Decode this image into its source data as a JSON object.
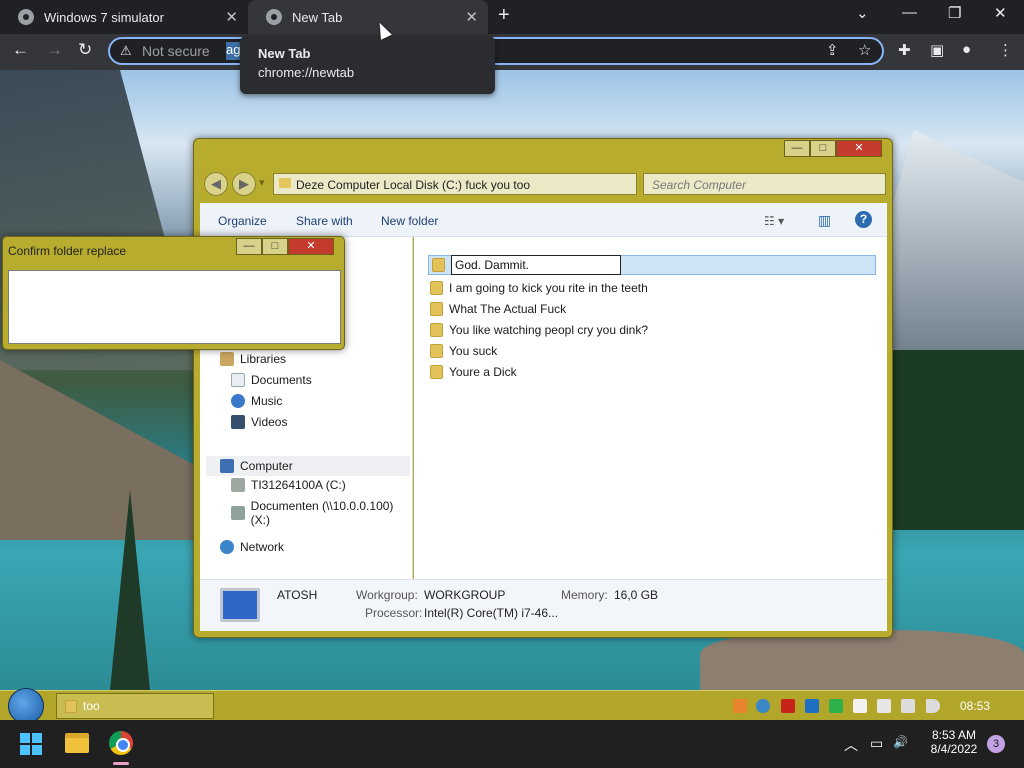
{
  "browser": {
    "tabs": [
      {
        "label": "Windows 7 simulator",
        "close": "✕"
      },
      {
        "label": "New Tab",
        "close": "✕"
      }
    ],
    "new_tab": "+",
    "window_controls": {
      "minimize": "⌄",
      "min": "—",
      "restore": "❐",
      "close": "✕"
    },
    "nav": {
      "back": "←",
      "forward": "→",
      "reload": "↻"
    },
    "address": {
      "security_icon": "⚠",
      "security_label": "Not secure",
      "selected_text": "ag"
    },
    "toolbar_icons": {
      "share": "⇪",
      "star": "☆",
      "extensions": "✚",
      "sidepanel": "▣",
      "profile": "●",
      "menu": "⋮"
    },
    "tooltip": {
      "title": "New Tab",
      "url": "chrome://newtab"
    }
  },
  "explorer": {
    "caption_buttons": {
      "min": "—",
      "max": "□",
      "close": "✕"
    },
    "nav": {
      "back": "◀",
      "forward": "▶",
      "dropdown": "▾"
    },
    "breadcrumb": "Deze Computer  Local Disk (C:)  fuck you  too",
    "search_placeholder": "Search Computer",
    "commands": {
      "organize": "Organize",
      "share_with": "Share with",
      "new_folder": "New folder",
      "views": "☷ ▾",
      "preview": "▥",
      "help": "?"
    },
    "nav_pane": {
      "libraries": "Libraries",
      "documents": "Documents",
      "music": "Music",
      "videos": "Videos",
      "computer": "Computer",
      "drive_c": "TI31264100A (C:)",
      "drive_x": "Documenten (\\\\10.0.0.100) (X:)",
      "network": "Network"
    },
    "files": {
      "rename_value": "God. Dammit.",
      "items": [
        "I am going to kick you rite in the teeth",
        "What The Actual Fuck",
        "You like watching peopl cry you dink?",
        "You suck",
        "Youre a Dick"
      ]
    },
    "details": {
      "name": "ATOSH",
      "workgroup_label": "Workgroup:",
      "workgroup": "WORKGROUP",
      "memory_label": "Memory:",
      "memory": "16,0 GB",
      "processor_label": "Processor:",
      "processor": "Intel(R) Core(TM) i7-46..."
    }
  },
  "confirm_dialog": {
    "title": "Confirm folder replace",
    "buttons": {
      "min": "—",
      "max": "□",
      "close": "✕"
    }
  },
  "win7_taskbar": {
    "task_label": "too",
    "clock": "08:53"
  },
  "win11_taskbar": {
    "time": "8:53 AM",
    "date": "8/4/2022",
    "tray": {
      "chevron": "︿",
      "network": "▭",
      "volume": "🔊"
    },
    "notifications": "3"
  },
  "colors": {
    "accent": "#b8ac2e",
    "chrome_dark": "#202124",
    "chrome_toolbar": "#35363a"
  }
}
